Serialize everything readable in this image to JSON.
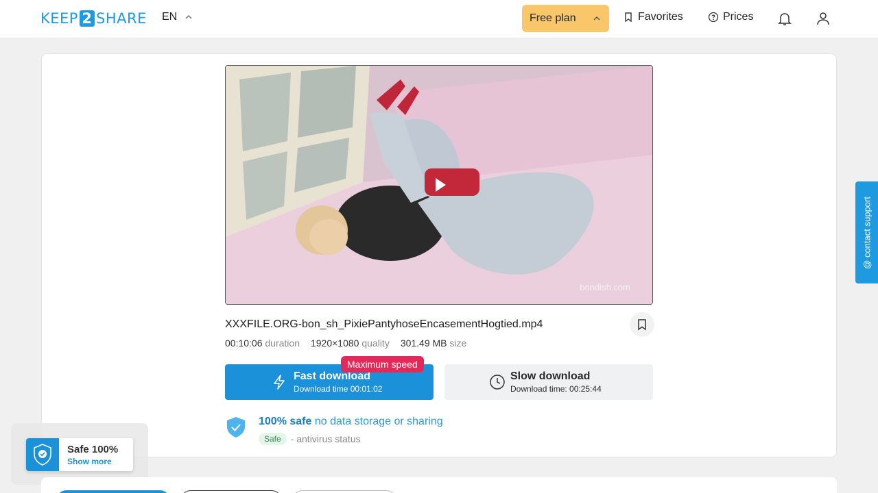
{
  "header": {
    "logo": {
      "left": "KEEP",
      "mid": "2",
      "right": "SHARE"
    },
    "language": "EN",
    "plan_label": "Free plan",
    "favorites_label": "Favorites",
    "prices_label": "Prices"
  },
  "video": {
    "watermark": "bondish.com"
  },
  "file": {
    "name": "XXXFILE.ORG-bon_sh_PixiePantyhoseEncasementHogtied.mp4",
    "duration": "00:10:06",
    "duration_label": "duration",
    "resolution": "1920×1080",
    "resolution_label": "quality",
    "size": "301.49 MB",
    "size_label": "size"
  },
  "download": {
    "fast_title": "Fast download",
    "fast_sub": "Download time 00:01:02",
    "max_badge": "Maximum speed",
    "slow_title": "Slow download",
    "slow_sub": "Download time: 00:25:44"
  },
  "safety": {
    "strong": "100% safe",
    "rest": "no data storage or sharing",
    "badge": "Safe",
    "status": "- antivirus status"
  },
  "contact_label": "@ contact support",
  "popup": {
    "title": "Safe 100%",
    "more": "Show more"
  },
  "colors": {
    "accent": "#1a91d8",
    "plan": "#f9c76a",
    "badge": "#e22a5a"
  }
}
